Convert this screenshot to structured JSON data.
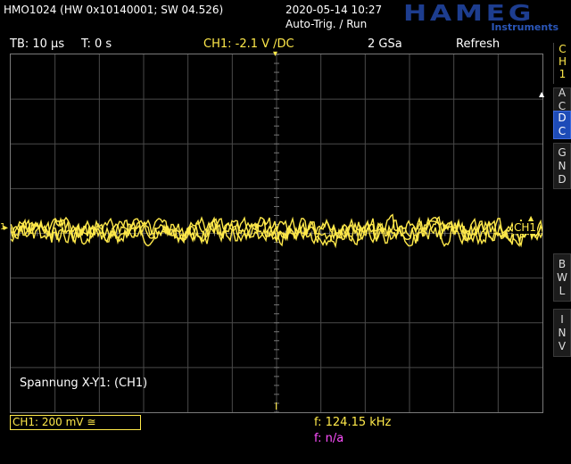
{
  "header": {
    "device": "HMO1024 (HW 0x10140001; SW 04.526)",
    "datetime": "2020-05-14 10:27",
    "trigger_status": "Auto-Trig. / Run"
  },
  "logo": {
    "brand": "HAMEG",
    "sub": "Instruments"
  },
  "status_bar": {
    "timebase": "TB: 10 µs",
    "trigger_time": "T: 0 s",
    "ch1_trigger": "CH1: -2.1 V ∕DC",
    "sample_rate": "2 GSa",
    "mode": "Refresh"
  },
  "side_panel": {
    "channel_letters": [
      "C",
      "H",
      "1"
    ],
    "buttons": [
      {
        "name": "ac",
        "letters": [
          "A",
          "C"
        ],
        "active": false
      },
      {
        "name": "dc",
        "letters": [
          "D",
          "C"
        ],
        "active": true
      },
      {
        "name": "gnd",
        "letters": [
          "G",
          "N",
          "D"
        ],
        "active": false
      },
      {
        "name": "bwl",
        "letters": [
          "B",
          "W",
          "L"
        ],
        "active": false
      },
      {
        "name": "inv",
        "letters": [
          "I",
          "N",
          "V"
        ],
        "active": false
      }
    ]
  },
  "waveform": {
    "channel_label": "CH1",
    "marker": "1",
    "color": "#ffe94a",
    "grid_color": "#4a4a4a"
  },
  "annotation": "Spannung X-Y1: (CH1)",
  "footer": {
    "ch1_scale": "CH1: 200 mV ≅",
    "frequency_1": "f: 124.15 kHz",
    "frequency_2": "f: n/a"
  },
  "colors": {
    "channel": "#ffe94a",
    "second": "#ff4fff",
    "brand": "#1d3d8f",
    "active_button": "#1d4bb8"
  }
}
